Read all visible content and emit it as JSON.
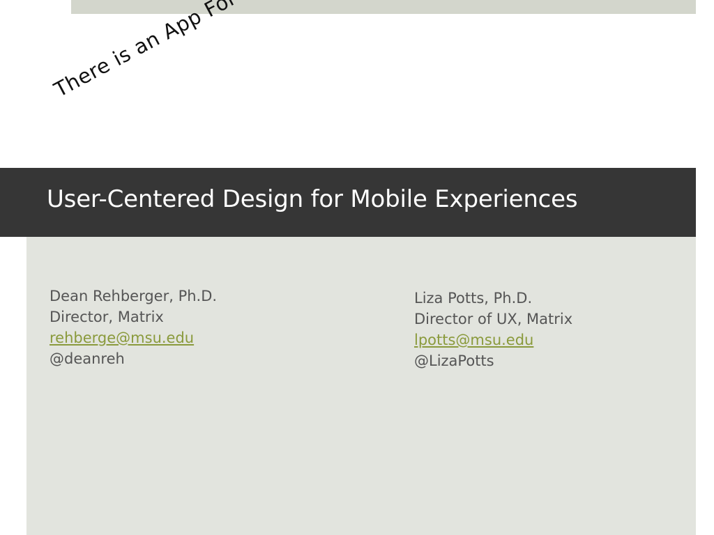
{
  "slide": {
    "tagline": "There is an App For That!",
    "title": "User-Centered Design for Mobile Experiences"
  },
  "authors": [
    {
      "name": "Dean Rehberger, Ph.D.",
      "role": "Director, Matrix",
      "email": "rehberge@msu.edu",
      "handle": "@deanreh"
    },
    {
      "name": "Liza Potts, Ph.D.",
      "role": "Director of UX, Matrix",
      "email": "lpotts@msu.edu",
      "handle": "@LizaPotts"
    }
  ],
  "colors": {
    "title_band": "#363636",
    "panel": "#e2e4de",
    "top_band": "#d3d6cc",
    "link": "#8a9a3c",
    "body_text": "#555555"
  }
}
